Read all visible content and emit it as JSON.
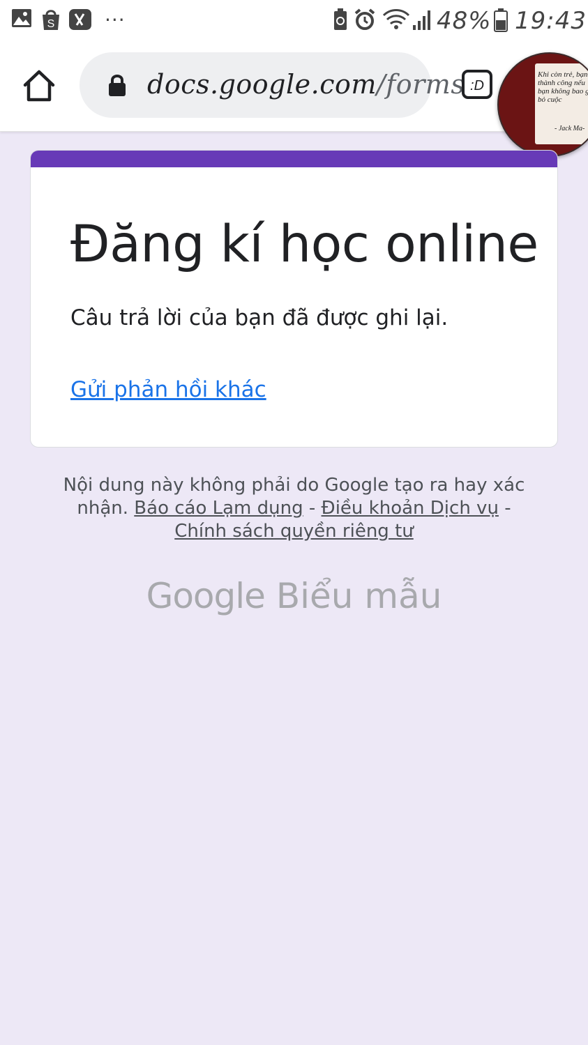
{
  "status_bar": {
    "battery": "48%",
    "time": "19:43",
    "more": "···",
    "left_icons": [
      "gallery-icon",
      "shopee-icon",
      "app-icon"
    ],
    "right_icons": [
      "battery-saver-icon",
      "alarm-icon",
      "wifi-icon",
      "signal-icon",
      "battery-icon"
    ]
  },
  "browser": {
    "url_domain": "docs.google.com",
    "url_path": "/forms",
    "tabs_label": ":D",
    "bubble_note": "Khi còn trẻ, bạn sẽ thành công nếu bạn không bao giờ bỏ cuộc",
    "bubble_author": "- Jack Ma-"
  },
  "form": {
    "accent_color": "#673ab7",
    "title": "Đăng kí học online",
    "confirmation": "Câu trả lời của bạn đã được ghi lại.",
    "resubmit_link": "Gửi phản hồi khác"
  },
  "footer": {
    "disclaimer": "Nội dung này không phải do Google tạo ra hay xác nhận.",
    "report_link": "Báo cáo Lạm dụng",
    "terms_link": "Điều khoản Dịch vụ",
    "privacy_link": "Chính sách quyền riêng tư",
    "separator": " - "
  },
  "brand": {
    "google": "Google",
    "product": "Biểu mẫu"
  }
}
